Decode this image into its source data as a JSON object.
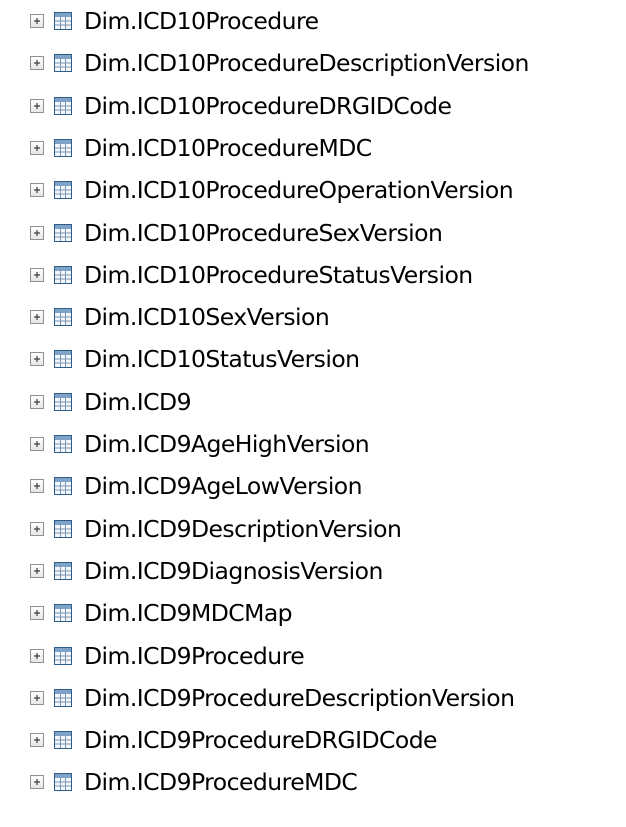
{
  "object_explorer": {
    "tables": [
      {
        "label": "Dim.ICD10Procedure",
        "expander_icon": "plus-box-icon",
        "table_icon": "table-icon"
      },
      {
        "label": "Dim.ICD10ProcedureDescriptionVersion",
        "expander_icon": "plus-box-icon",
        "table_icon": "table-icon"
      },
      {
        "label": "Dim.ICD10ProcedureDRGIDCode",
        "expander_icon": "plus-box-icon",
        "table_icon": "table-icon"
      },
      {
        "label": "Dim.ICD10ProcedureMDC",
        "expander_icon": "plus-box-icon",
        "table_icon": "table-icon"
      },
      {
        "label": "Dim.ICD10ProcedureOperationVersion",
        "expander_icon": "plus-box-icon",
        "table_icon": "table-icon"
      },
      {
        "label": "Dim.ICD10ProcedureSexVersion",
        "expander_icon": "plus-box-icon",
        "table_icon": "table-icon"
      },
      {
        "label": "Dim.ICD10ProcedureStatusVersion",
        "expander_icon": "plus-box-icon",
        "table_icon": "table-icon"
      },
      {
        "label": "Dim.ICD10SexVersion",
        "expander_icon": "plus-box-icon",
        "table_icon": "table-icon"
      },
      {
        "label": "Dim.ICD10StatusVersion",
        "expander_icon": "plus-box-icon",
        "table_icon": "table-icon"
      },
      {
        "label": "Dim.ICD9",
        "expander_icon": "plus-box-icon",
        "table_icon": "table-icon"
      },
      {
        "label": "Dim.ICD9AgeHighVersion",
        "expander_icon": "plus-box-icon",
        "table_icon": "table-icon"
      },
      {
        "label": "Dim.ICD9AgeLowVersion",
        "expander_icon": "plus-box-icon",
        "table_icon": "table-icon"
      },
      {
        "label": "Dim.ICD9DescriptionVersion",
        "expander_icon": "plus-box-icon",
        "table_icon": "table-icon"
      },
      {
        "label": "Dim.ICD9DiagnosisVersion",
        "expander_icon": "plus-box-icon",
        "table_icon": "table-icon"
      },
      {
        "label": "Dim.ICD9MDCMap",
        "expander_icon": "plus-box-icon",
        "table_icon": "table-icon"
      },
      {
        "label": "Dim.ICD9Procedure",
        "expander_icon": "plus-box-icon",
        "table_icon": "table-icon"
      },
      {
        "label": "Dim.ICD9ProcedureDescriptionVersion",
        "expander_icon": "plus-box-icon",
        "table_icon": "table-icon"
      },
      {
        "label": "Dim.ICD9ProcedureDRGIDCode",
        "expander_icon": "plus-box-icon",
        "table_icon": "table-icon"
      },
      {
        "label": "Dim.ICD9ProcedureMDC",
        "expander_icon": "plus-box-icon",
        "table_icon": "table-icon"
      }
    ]
  }
}
